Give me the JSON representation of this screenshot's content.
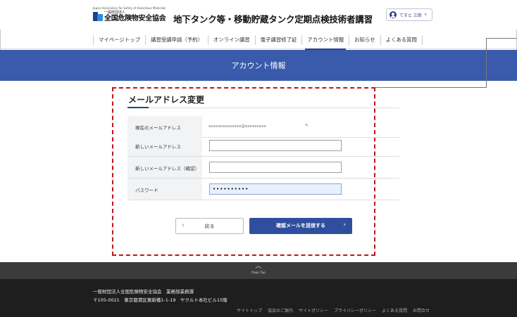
{
  "header": {
    "org_tagline": "Japan Association for Safety of Hazardous Materials",
    "org_type": "一般財団法人",
    "org_name": "全国危険物安全協会",
    "site_title": "地下タンク等・移動貯蔵タンク定期点検技術者講習",
    "user_name": "てすと 三郎",
    "user_caret": "▾"
  },
  "nav": {
    "items": [
      {
        "label": "マイページトップ"
      },
      {
        "label": "講習受講申請（予約）"
      },
      {
        "label": "オンライン講習"
      },
      {
        "label": "電子講習修了証"
      },
      {
        "label": "アカウント情報"
      },
      {
        "label": "お知らせ"
      },
      {
        "label": "よくある質問"
      }
    ],
    "active": "アカウント情報"
  },
  "band": {
    "title": "アカウント情報"
  },
  "form": {
    "section_title": "メールアドレス変更",
    "rows": [
      {
        "label": "現在のメールアドレス",
        "value": "xxxxxxxxxxxxxx@xxxxxxxxx"
      },
      {
        "label": "新しいメールアドレス",
        "value": ""
      },
      {
        "label": "新しいメールアドレス（確認）",
        "value": ""
      },
      {
        "label": "パスワード",
        "value": "••••••••••"
      }
    ],
    "cursor_mark": "↖",
    "back_label": "戻る",
    "submit_label": "確認メールを送信する"
  },
  "footer": {
    "pagetop_arrow": "︿",
    "pagetop_label": "Page Top",
    "address_line1": "一般財団法人全国危険物安全協会　業務部業務課",
    "address_line2": "〒105-0021　東京都港区東新橋1-1-19　ヤクルト本社ビル15階",
    "links": [
      "サイトトップ",
      "協会のご案内",
      "サイトポリシー",
      "プライバシーポリシー",
      "よくある質問",
      "お問合せ"
    ]
  },
  "colors": {
    "brand_blue": "#3a5bab",
    "button_blue": "#2f4f9e",
    "annotation_red": "#c0141b",
    "footer_dark": "#1e1e1e"
  }
}
